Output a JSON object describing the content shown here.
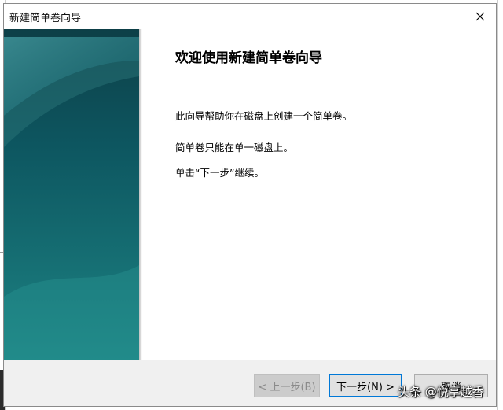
{
  "dialog": {
    "title": "新建简单卷向导"
  },
  "content": {
    "heading": "欢迎使用新建简单卷向导",
    "line1": "此向导帮助你在磁盘上创建一个简单卷。",
    "line2": "简单卷只能在单一磁盘上。",
    "line3": "单击“下一步”继续。"
  },
  "buttons": {
    "back": "< 上一步(B)",
    "next": "下一步(N) >",
    "cancel": "取消"
  },
  "icons": {
    "close": "close-icon"
  },
  "watermark": "头条 @悦享越香",
  "colors": {
    "accent": "#0078d7",
    "side_panel_dark": "#0d5660",
    "side_panel_light": "#2a8f8f"
  }
}
